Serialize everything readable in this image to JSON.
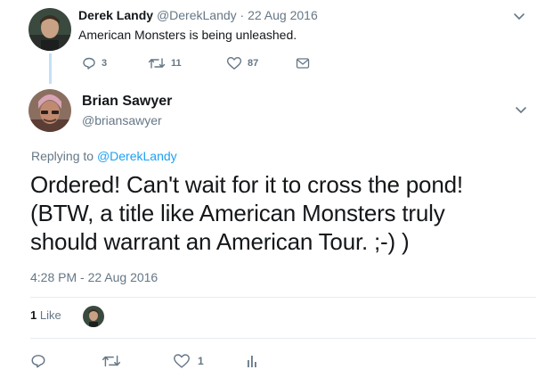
{
  "parent_tweet": {
    "author_name": "Derek Landy",
    "handle": "@DerekLandy",
    "date": "22 Aug 2016",
    "separator": " · ",
    "text": "American Monsters is being unleashed.",
    "reply_count": "3",
    "retweet_count": "11",
    "like_count": "87",
    "icons": [
      "reply-icon",
      "retweet-icon",
      "heart-icon",
      "envelope-icon",
      "chevron-down-icon"
    ]
  },
  "tweet": {
    "author_name": "Brian Sawyer",
    "handle": "@briansawyer",
    "replying_prefix": "Replying to ",
    "replying_to": "@DerekLandy",
    "text_lines": [
      "Ordered! Can't wait for it to cross the pond!",
      "(BTW, a title like American Monsters truly",
      "should warrant an American Tour. ;-) )"
    ],
    "timestamp": "4:28 PM - 22 Aug 2016",
    "likes_count": "1",
    "likes_label": "Like",
    "like_count": "1",
    "icons": [
      "reply-icon",
      "retweet-icon",
      "heart-icon",
      "analytics-icon",
      "chevron-down-icon"
    ]
  },
  "colors": {
    "link_blue": "#1da1f2",
    "secondary_text": "#657786",
    "primary_text": "#14171a",
    "thread_line": "#c4e0f5",
    "divider": "#e6ecf0"
  }
}
